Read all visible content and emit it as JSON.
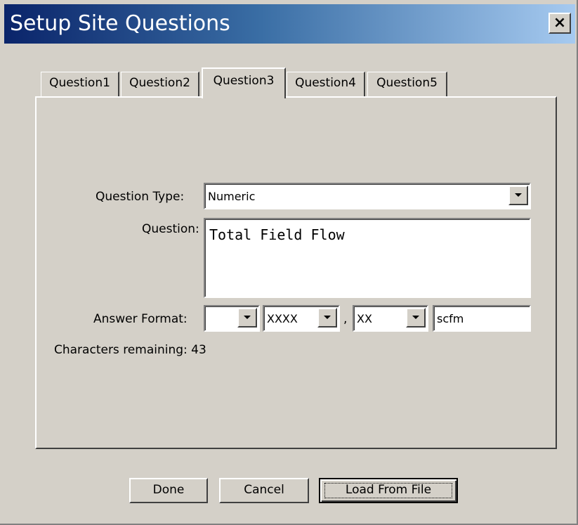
{
  "window": {
    "title": "Setup Site Questions",
    "close_label": "×"
  },
  "tabs": [
    {
      "label": "Question1",
      "active": false
    },
    {
      "label": "Question2",
      "active": false
    },
    {
      "label": "Question3",
      "active": true
    },
    {
      "label": "Question4",
      "active": false
    },
    {
      "label": "Question5",
      "active": false
    }
  ],
  "form": {
    "question_type_label": "Question Type:",
    "question_type_value": "Numeric",
    "question_label": "Question:",
    "question_value": "Total Field Flow",
    "answer_format_label": "Answer Format:",
    "answer_format": {
      "prefix_value": "",
      "integer_digits_value": "XXXX",
      "separator": ",",
      "decimal_digits_value": "XX",
      "units_value": "scfm"
    },
    "characters_remaining_text": "Characters remaining: 43"
  },
  "buttons": {
    "done_label": "Done",
    "cancel_label": "Cancel",
    "load_label": "Load From File"
  },
  "colors": {
    "dialog_face": "#d4d0c8",
    "title_gradient_start": "#0a246a",
    "title_gradient_end": "#a6caf0"
  },
  "icons": {
    "close": "close-icon",
    "dropdown": "chevron-down-icon"
  }
}
